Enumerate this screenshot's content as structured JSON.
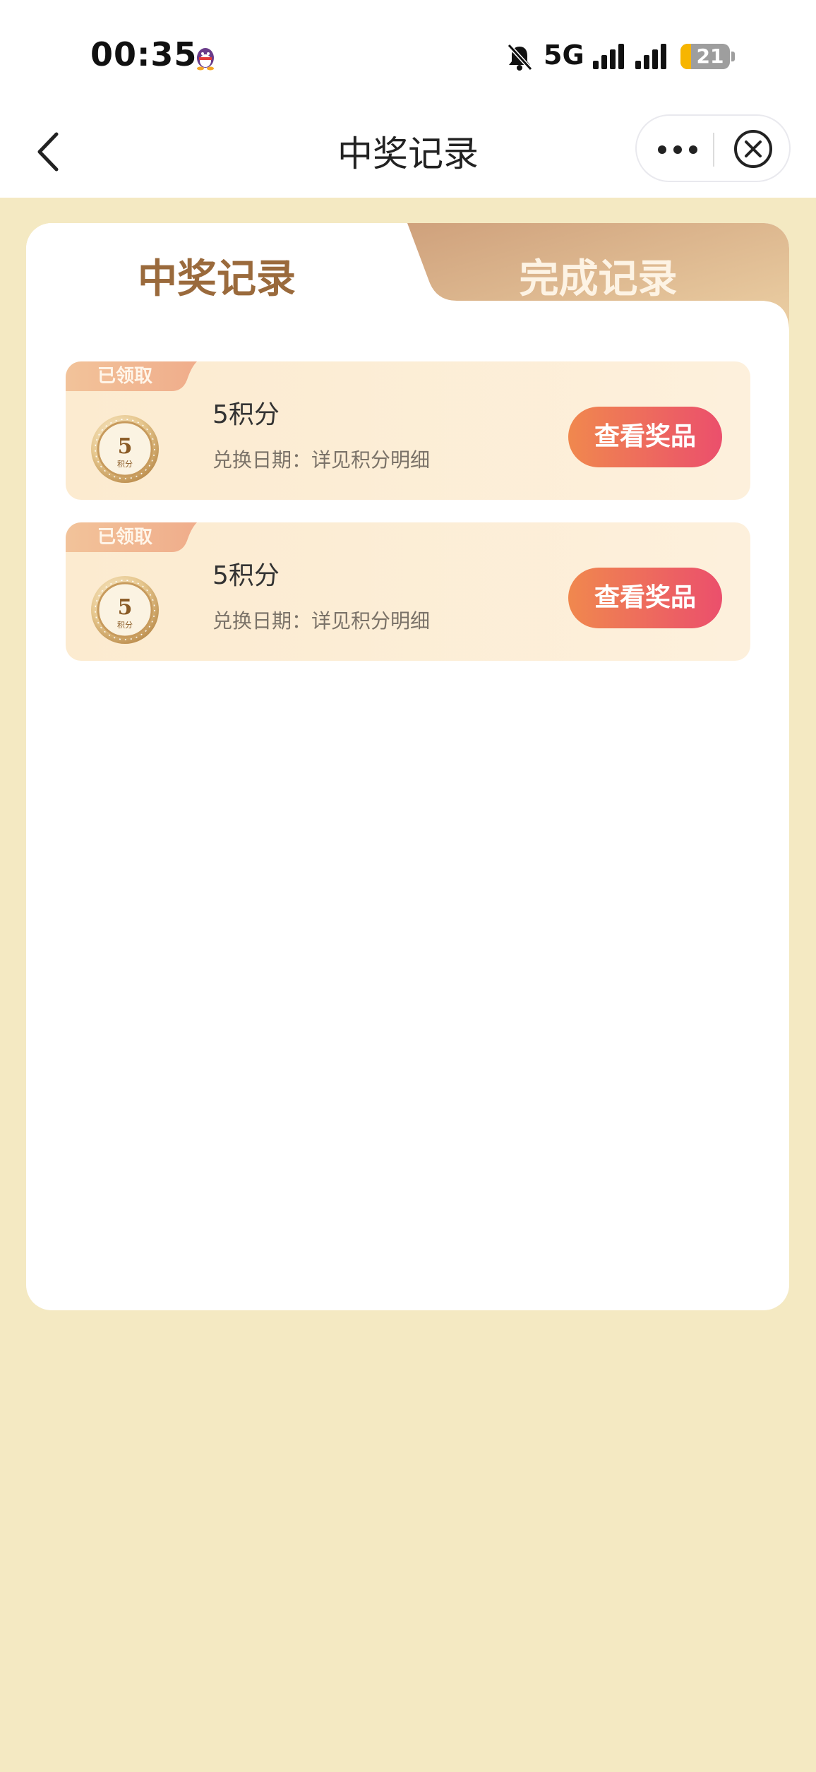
{
  "status_bar": {
    "time": "00:35",
    "network": "5G",
    "battery_level": "21",
    "battery_fraction": 0.21
  },
  "nav": {
    "title": "中奖记录",
    "back_icon": "chevron-left-icon",
    "more_icon": "more-dots-icon",
    "close_icon": "close-circle-icon"
  },
  "tabs": [
    {
      "label": "中奖记录",
      "active": true
    },
    {
      "label": "完成记录",
      "active": false
    }
  ],
  "records": [
    {
      "status": "已领取",
      "coin_value": "5",
      "coin_unit": "积分",
      "name": "5积分",
      "date": "兑换日期：详见积分明细",
      "button": "查看奖品"
    },
    {
      "status": "已领取",
      "coin_value": "5",
      "coin_unit": "积分",
      "name": "5积分",
      "date": "兑换日期：详见积分明细",
      "button": "查看奖品"
    }
  ],
  "colors": {
    "page_background": "#f4e9c2",
    "active_tab_text": "#9a6a3c",
    "inactive_tab_bg": "#d9aa80",
    "button_gradient_start": "#f0884e",
    "button_gradient_end": "#eb4f6c"
  }
}
